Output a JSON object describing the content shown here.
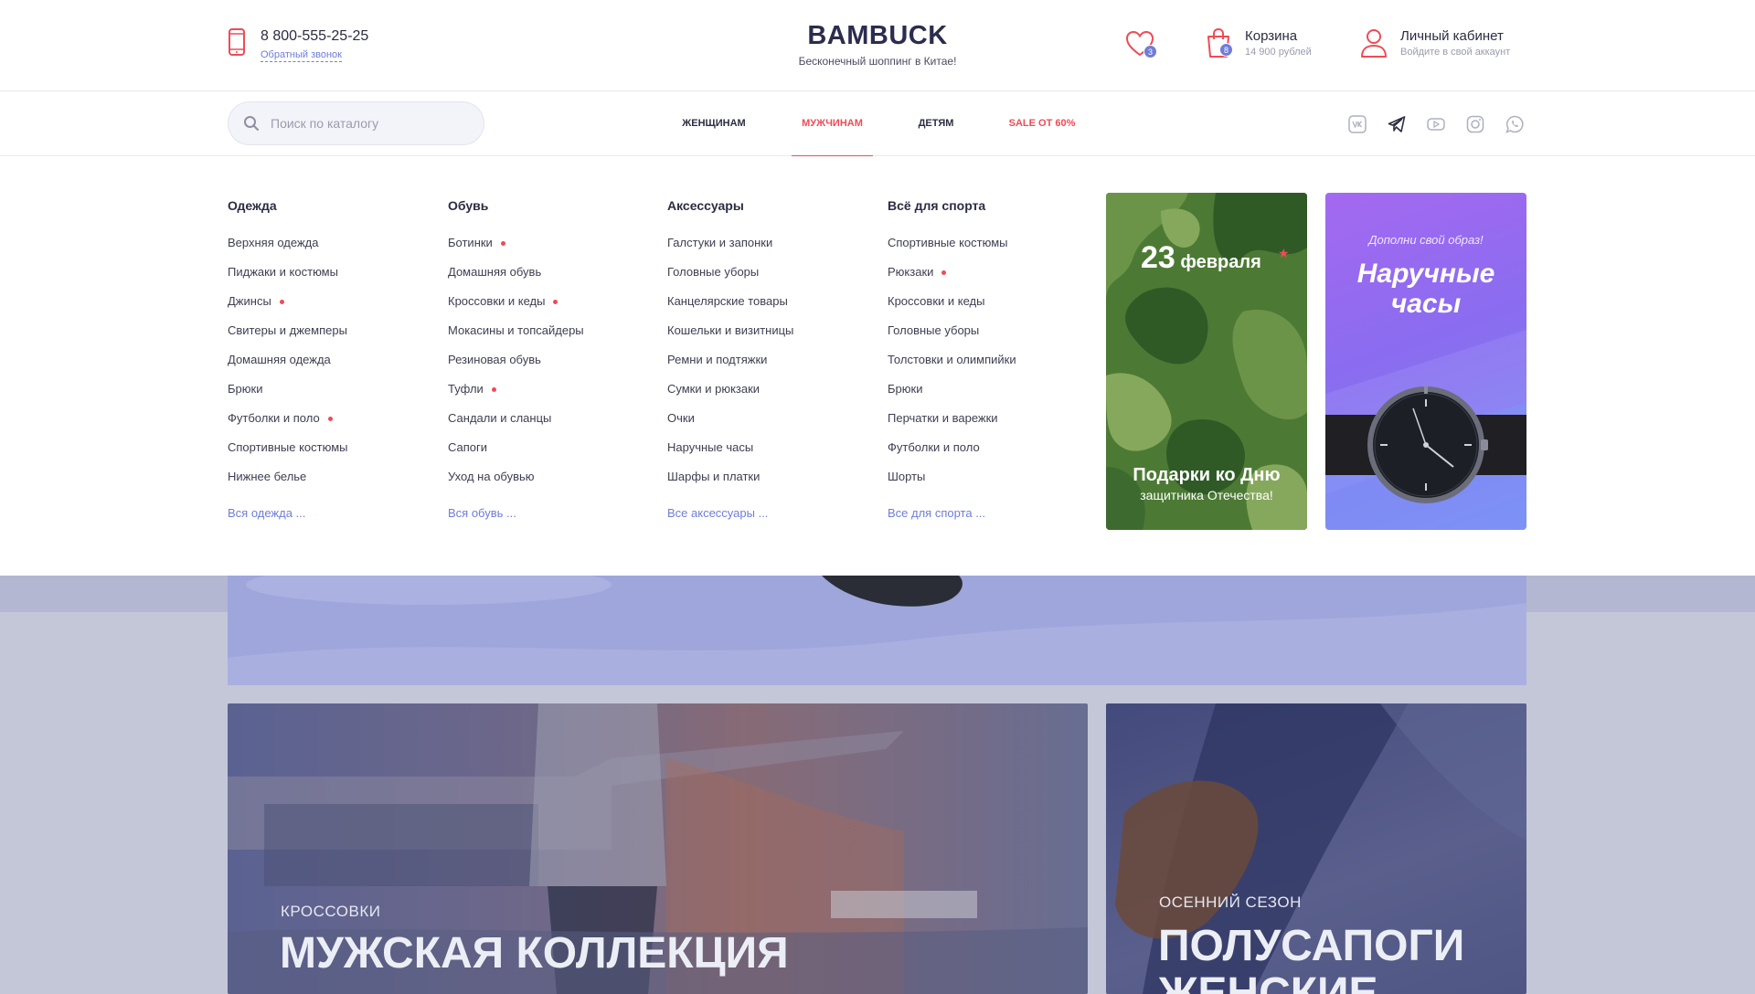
{
  "header": {
    "phone": "8 800-555-25-25",
    "callback_label": "Обратный звонок",
    "logo_title": "BAMBUCK",
    "logo_subtitle": "Бесконечный шоппинг в Китае!",
    "favorites_count": "3",
    "cart_count": "8",
    "cart_title": "Корзина",
    "cart_sum": "14 900 рублей",
    "account_title": "Личный кабинет",
    "account_sub": "Войдите в свой аккаунт",
    "accent_color": "#ef4b55",
    "link_color": "#6f7dd9"
  },
  "search": {
    "placeholder": "Поиск по каталогу",
    "value": ""
  },
  "nav": {
    "items": [
      {
        "label": "Женщинам",
        "state": "normal"
      },
      {
        "label": "Мужчинам",
        "state": "active"
      },
      {
        "label": "Детям",
        "state": "normal"
      },
      {
        "label": "Sale от 60%",
        "state": "sale"
      }
    ]
  },
  "socials": [
    "vk-icon",
    "telegram-icon",
    "youtube-icon",
    "instagram-icon",
    "whatsapp-icon"
  ],
  "mega": {
    "columns": [
      {
        "title": "Одежда",
        "items": [
          {
            "label": "Верхняя одежда"
          },
          {
            "label": "Пиджаки и костюмы"
          },
          {
            "label": "Джинсы",
            "dot": true
          },
          {
            "label": "Свитеры и джемперы"
          },
          {
            "label": "Домашняя одежда"
          },
          {
            "label": "Брюки"
          },
          {
            "label": "Футболки и поло",
            "dot": true
          },
          {
            "label": "Спортивные костюмы"
          },
          {
            "label": "Нижнее белье"
          }
        ],
        "more": "Вся одежда ..."
      },
      {
        "title": "Обувь",
        "items": [
          {
            "label": "Ботинки",
            "dot": true
          },
          {
            "label": "Домашняя обувь"
          },
          {
            "label": "Кроссовки и кеды",
            "dot": true
          },
          {
            "label": "Мокасины и топсайдеры"
          },
          {
            "label": "Резиновая обувь"
          },
          {
            "label": "Туфли",
            "dot": true
          },
          {
            "label": "Сандали и сланцы"
          },
          {
            "label": "Сапоги"
          },
          {
            "label": "Уход на обувью"
          }
        ],
        "more": "Вся обувь ..."
      },
      {
        "title": "Аксессуары",
        "items": [
          {
            "label": "Галстуки и запонки"
          },
          {
            "label": "Головные уборы"
          },
          {
            "label": "Канцелярские товары"
          },
          {
            "label": "Кошельки и визитницы"
          },
          {
            "label": "Ремни и подтяжки"
          },
          {
            "label": "Сумки и рюкзаки"
          },
          {
            "label": "Очки"
          },
          {
            "label": "Наручные часы"
          },
          {
            "label": "Шарфы и платки"
          }
        ],
        "more": "Все аксессуары ..."
      },
      {
        "title": "Всё для спорта",
        "items": [
          {
            "label": "Спортивные костюмы"
          },
          {
            "label": "Рюкзаки",
            "dot": true
          },
          {
            "label": "Кроссовки и кеды"
          },
          {
            "label": "Головные уборы"
          },
          {
            "label": "Толстовки и олимпийки"
          },
          {
            "label": "Брюки"
          },
          {
            "label": "Перчатки и варежки"
          },
          {
            "label": "Футболки и поло"
          },
          {
            "label": "Шорты"
          }
        ],
        "more": "Все для спорта ..."
      }
    ],
    "promo_feb": {
      "number": "23",
      "month": "февраля",
      "line1": "Подарки ко Дню",
      "line2": "защитника Отечества!"
    },
    "promo_watch": {
      "subtitle": "Дополни свой образ!",
      "title_line1": "Наручные",
      "title_line2": "часы"
    }
  },
  "cards": [
    {
      "category": "Кроссовки",
      "title": "Мужская коллекция"
    },
    {
      "category": "Осенний сезон",
      "title_line1": "Полусапоги",
      "title_line2": "женские"
    }
  ]
}
